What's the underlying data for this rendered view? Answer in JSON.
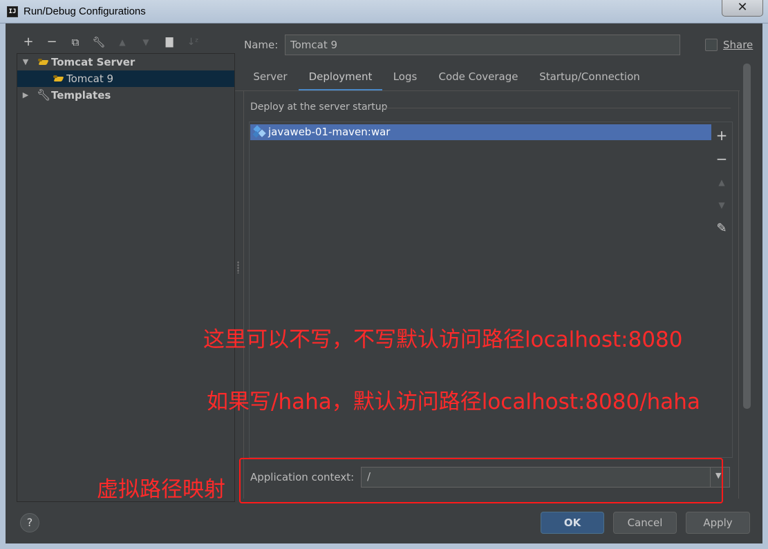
{
  "window": {
    "title": "Run/Debug Configurations",
    "app_icon": "IJ",
    "close": "✕"
  },
  "toolbar": {
    "icons": [
      "plus-icon",
      "minus-icon",
      "copy-icon",
      "wrench-icon",
      "arrow-up-icon",
      "arrow-down-icon",
      "folder-add-icon",
      "sort-icon"
    ]
  },
  "tree": {
    "items": [
      {
        "label": "Tomcat Server",
        "expanded": true,
        "bold": true
      },
      {
        "label": "Tomcat 9",
        "selected": true
      },
      {
        "label": "Templates",
        "expanded": false,
        "bold": true
      }
    ]
  },
  "form": {
    "name_label": "Name:",
    "name_value": "Tomcat 9",
    "share_label": "Share",
    "share_checked": false
  },
  "tabs": [
    {
      "label": "Server"
    },
    {
      "label": "Deployment",
      "active": true
    },
    {
      "label": "Logs"
    },
    {
      "label": "Code Coverage"
    },
    {
      "label": "Startup/Connection"
    }
  ],
  "deployment": {
    "group_title": "Deploy at the server startup",
    "artifacts": [
      "javaweb-01-maven:war"
    ],
    "side_buttons": [
      "+",
      "−",
      "▲",
      "▼",
      "✎"
    ],
    "context_label": "Application context:",
    "context_value": "/"
  },
  "annotations": {
    "line1": "这里可以不写，不写默认访问路径localhost:8080",
    "line2": "如果写/haha，默认访问路径localhost:8080/haha",
    "line3": "虚拟路径映射"
  },
  "buttons": {
    "help": "?",
    "ok": "OK",
    "cancel": "Cancel",
    "apply": "Apply"
  },
  "colors": {
    "background": "#3c3f41",
    "selection": "#4b6eaf",
    "accent": "#4a88c7",
    "annotation": "#ff2a2a"
  }
}
